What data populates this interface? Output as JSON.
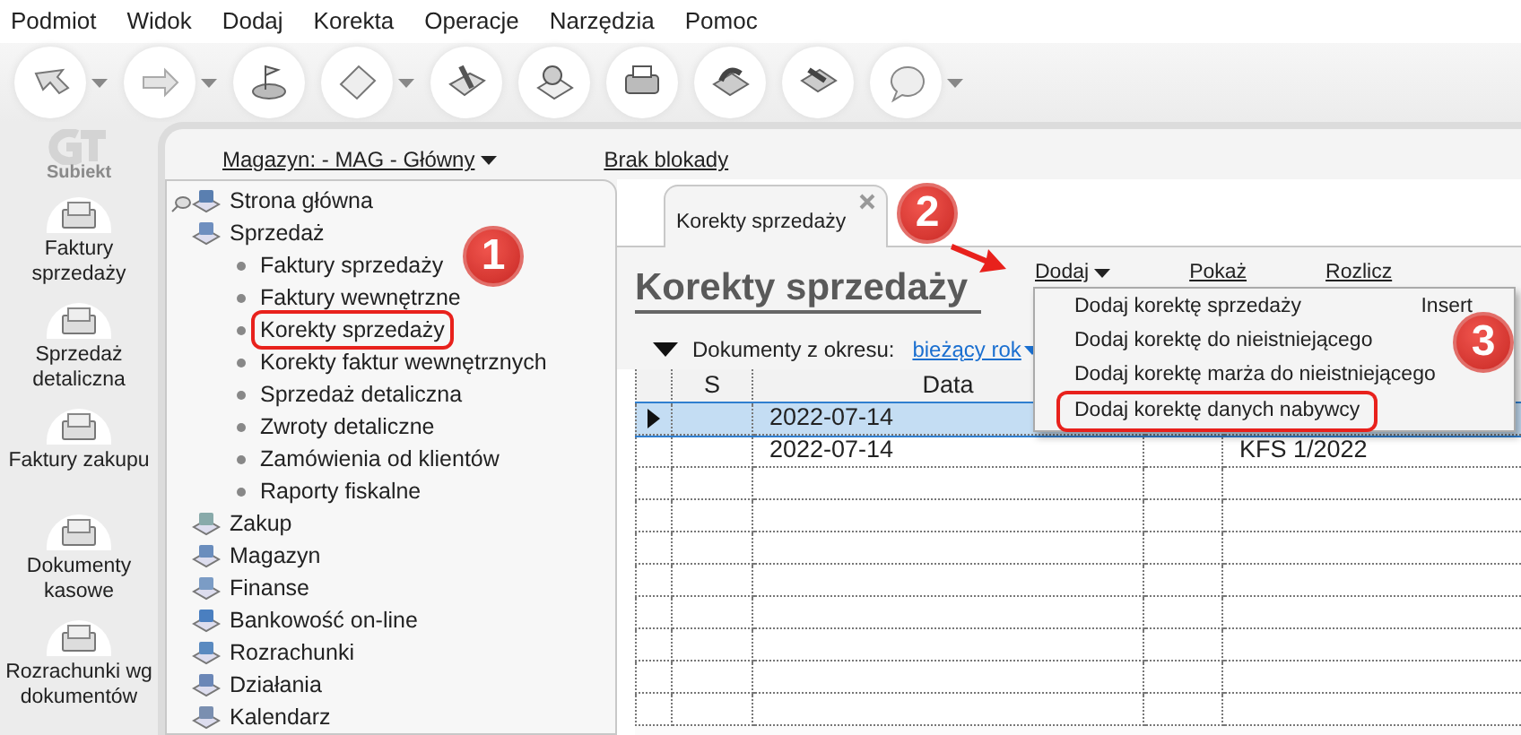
{
  "menu_bar": [
    "Podmiot",
    "Widok",
    "Dodaj",
    "Korekta",
    "Operacje",
    "Narzędzia",
    "Pomoc"
  ],
  "toolbar": [
    {
      "dropdown": true
    },
    {
      "dropdown": true
    },
    {
      "dropdown": false
    },
    {
      "dropdown": true
    },
    {
      "dropdown": false
    },
    {
      "dropdown": false
    },
    {
      "dropdown": false
    },
    {
      "dropdown": false
    },
    {
      "dropdown": false
    },
    {
      "dropdown": true
    }
  ],
  "nav_rail": {
    "logo_text": "Subiekt",
    "items": [
      "Faktury sprzedaży",
      "Sprzedaż detaliczna",
      "Faktury zakupu",
      "Dokumenty kasowe",
      "Rozrachunki wg dokumentów"
    ]
  },
  "header": {
    "warehouse": "Magazyn: - MAG - Główny",
    "lock": "Brak blokady"
  },
  "tree": [
    {
      "label": "Strona główna"
    },
    {
      "label": "Sprzedaż",
      "children": [
        {
          "label": "Faktury sprzedaży",
          "outlined": false
        },
        {
          "label": "Faktury wewnętrzne",
          "outlined": false
        },
        {
          "label": "Korekty sprzedaży",
          "outlined": true
        },
        {
          "label": "Korekty faktur wewnętrznych",
          "outlined": false
        },
        {
          "label": "Sprzedaż detaliczna",
          "outlined": false
        },
        {
          "label": "Zwroty detaliczne",
          "outlined": false
        },
        {
          "label": "Zamówienia od klientów",
          "outlined": false
        },
        {
          "label": "Raporty fiskalne",
          "outlined": false
        }
      ]
    },
    {
      "label": "Zakup"
    },
    {
      "label": "Magazyn"
    },
    {
      "label": "Finanse"
    },
    {
      "label": "Bankowość on-line"
    },
    {
      "label": "Rozrachunki"
    },
    {
      "label": "Działania"
    },
    {
      "label": "Kalendarz"
    }
  ],
  "tabs": [
    {
      "label": "Korekty sprzedaży",
      "selected": true
    }
  ],
  "title": "Korekty sprzedaży",
  "actions": [
    {
      "label": "Dodaj",
      "dropdown": true
    },
    {
      "label": "Pokaż",
      "dropdown": false
    },
    {
      "label": "Rozlicz",
      "dropdown": false
    }
  ],
  "filter": {
    "label": "Dokumenty z okresu:",
    "value": "bieżący rok"
  },
  "table": {
    "columns": [
      {
        "label": "S"
      },
      {
        "label": "Data"
      }
    ],
    "rows": [
      {
        "selected": true,
        "data": "2022-07-14"
      },
      {
        "selected": false,
        "data": "2022-07-14",
        "column_5": "KFS 1/2022"
      }
    ]
  },
  "dropdown_menu": [
    {
      "label": "Dodaj korektę sprzedaży",
      "shortcut": "Insert",
      "outlined": false
    },
    {
      "label": "Dodaj korektę do nieistniejącego",
      "outlined": false
    },
    {
      "label": "Dodaj korektę marża do nieistniejącego",
      "outlined": false
    },
    {
      "label": "Dodaj korektę danych nabywcy",
      "outlined": true
    }
  ],
  "annotations": {
    "badges": [
      "1",
      "2",
      "3"
    ]
  }
}
